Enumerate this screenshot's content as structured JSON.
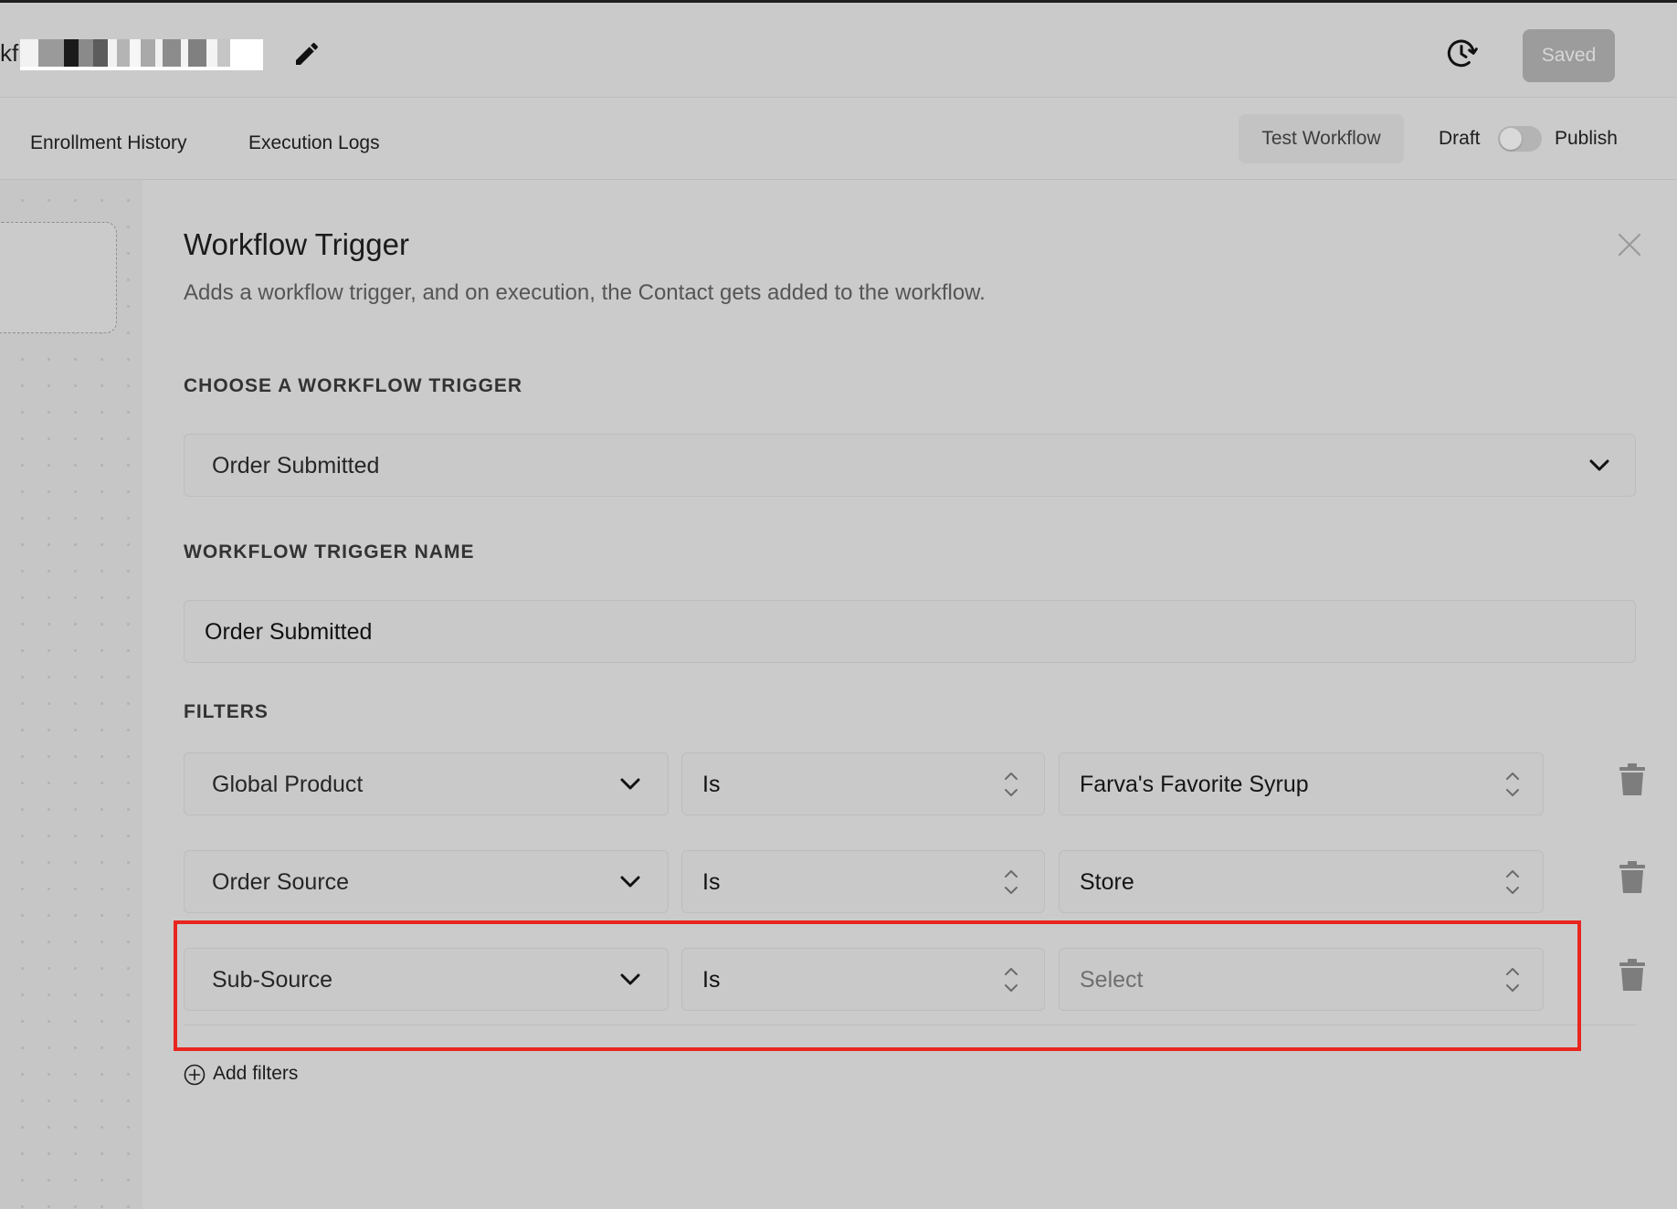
{
  "header": {
    "workflow_name_prefix": "kf",
    "saved_label": "Saved",
    "icons": [
      "pencil-icon",
      "history-icon"
    ]
  },
  "tabs": {
    "enrollment_history": "Enrollment History",
    "execution_logs": "Execution Logs",
    "test_workflow": "Test Workflow",
    "draft": "Draft",
    "publish": "Publish",
    "publish_toggle_on": false
  },
  "panel": {
    "title": "Workflow Trigger",
    "description": "Adds a workflow trigger, and on execution, the Contact gets added to the workflow.",
    "choose_trigger_label": "CHOOSE A WORKFLOW TRIGGER",
    "selected_trigger": "Order Submitted",
    "trigger_name_label": "WORKFLOW TRIGGER NAME",
    "trigger_name_value": "Order Submitted",
    "filters_label": "FILTERS",
    "filters": [
      {
        "field": "Global Product",
        "operator": "Is",
        "value": "Farva's Favorite Syrup",
        "placeholder": false
      },
      {
        "field": "Order Source",
        "operator": "Is",
        "value": "Store",
        "placeholder": false
      },
      {
        "field": "Sub-Source",
        "operator": "Is",
        "value": "Select",
        "placeholder": true
      }
    ],
    "add_filters_label": "Add filters"
  },
  "colors": {
    "background": "#cbcbcb",
    "highlight_border": "#e8261f",
    "saved_button_bg": "#9c9c9c"
  }
}
